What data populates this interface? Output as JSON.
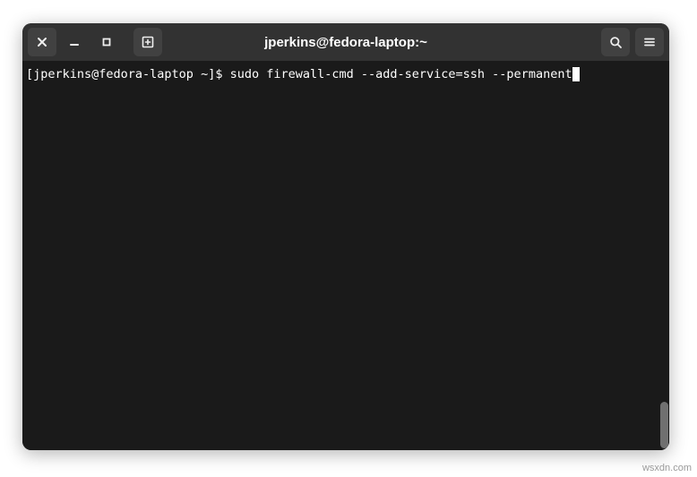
{
  "window": {
    "title": "jperkins@fedora-laptop:~"
  },
  "terminal": {
    "prompt": "[jperkins@fedora-laptop ~]$ ",
    "command": "sudo firewall-cmd --add-service=ssh --permanent"
  },
  "watermark": "wsxdn.com"
}
